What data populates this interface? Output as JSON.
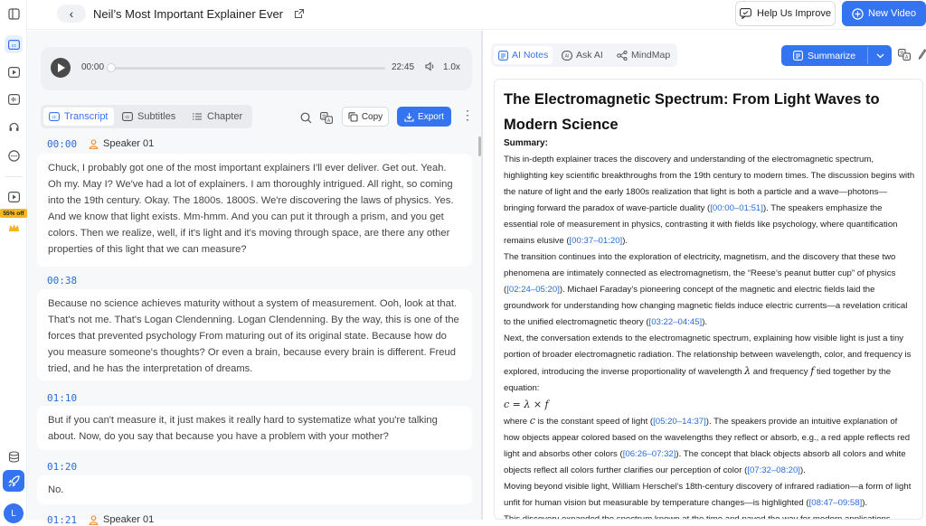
{
  "header": {
    "title": "Neil’s Most Important Explainer Ever",
    "help_label": "Help Us Improve",
    "new_video_label": "New Video"
  },
  "sidebar": {
    "badge": "55% off",
    "avatar_letter": "L"
  },
  "player": {
    "current_time": "00:00",
    "duration": "22:45",
    "speed": "1.0x",
    "progress": 0
  },
  "left_tabs": [
    "Transcript",
    "Subtitles",
    "Chapter"
  ],
  "toolbar": {
    "copy_label": "Copy",
    "export_label": "Export"
  },
  "segments": [
    {
      "time": "00:00",
      "speaker": "Speaker 01",
      "text": "Chuck, I probably got one of the most important explainers I'll ever deliver. Get out. Yeah. Oh my. May I? We've had a lot of explainers. I am thoroughly intrigued. All right, so coming into the 19th century. Okay. The 1800s. 1800S. We're discovering the laws of physics. Yes. And we know that light exists. Mm-hmm. And you can put it through a prism, and you get colors. Then we realize, well, if it's light and it's moving through space, are there any other properties of this light that we can measure?"
    },
    {
      "time": "00:38",
      "speaker": "",
      "text": "Because no science achieves maturity without a system of measurement. Ooh, look at that. That's not me. That's Logan Clendenning. Logan Clendenning. By the way, this is one of the forces that prevented psychology From maturing out of its original state. Because how do you measure someone's thoughts? Or even a brain, because every brain is different. Freud tried, and he has the interpretation of dreams."
    },
    {
      "time": "01:10",
      "speaker": "",
      "text": "But if you can't measure it, it just makes it really hard to systematize what you're talking about. Now, do you say that because you have a problem with your mother?"
    },
    {
      "time": "01:20",
      "speaker": "",
      "text": "No."
    },
    {
      "time": "01:21",
      "speaker": "Speaker 01",
      "text": ""
    }
  ],
  "right_tabs": [
    "AI Notes",
    "Ask AI",
    "MindMap"
  ],
  "summarize_label": "Summarize",
  "notes": {
    "title": "The Electromagnetic Spectrum: From Light Waves to Modern Science",
    "summary_label": "Summary:",
    "p1a": "This in-depth explainer traces the discovery and understanding of the electromagnetic spectrum, highlighting key scientific breakthroughs from the 19th century to modern times. The discussion begins with the nature of light and the early 1800s realization that light is both a particle and a wave—photons—bringing forward the paradox of wave-particle duality (",
    "ts1": "[00:00–01:51]",
    "p1b": "). The speakers emphasize the essential role of measurement in physics, contrasting it with fields like psychology, where quantification remains elusive (",
    "ts2": "[00:37–01:20]",
    "p1c": ").",
    "p2a": "The transition continues into the exploration of electricity, magnetism, and the discovery that these two phenomena are intimately connected as electromagnetism, the “Reese’s peanut butter cup” of physics (",
    "ts3": "[02:24–05:20]",
    "p2b": "). Michael Faraday’s pioneering concept of the magnetic and electric fields laid the groundwork for understanding how changing magnetic fields induce electric currents—a revelation critical to the unified electromagnetic theory (",
    "ts4": "[03:22–04:45]",
    "p2c": ").",
    "p3a": "Next, the conversation extends to the electromagnetic spectrum, explaining how visible light is just a tiny portion of broader electromagnetic radiation. The relationship between wavelength, color, and frequency is explored, introducing the inverse proportionality of wavelength ",
    "sym_lambda": "λ",
    "p3b": " and frequency ",
    "sym_f": "f",
    "p3c": " tied together by the equation:",
    "equation": "c = λ × f",
    "p4a": "where ",
    "sym_c": "c",
    "p4b": " is the constant speed of light (",
    "ts5": "[05:20–14:37]",
    "p4c": "). The speakers provide an intuitive explanation of how objects appear colored based on the wavelengths they reflect or absorb, e.g., a red apple reflects red light and absorbs other colors (",
    "ts6": "[06:26–07:32]",
    "p4d": "). The concept that black objects absorb all colors and white objects reflect all colors further clarifies our perception of color (",
    "ts7": "[07:32–08:20]",
    "p4e": ").",
    "p5a": "Moving beyond visible light, William Herschel’s 18th-century discovery of infrared radiation—a form of light unfit for human vision but measurable by temperature changes—is highlighted (",
    "ts8": "[08:47–09:58]",
    "p5b": ").",
    "p6": "This discovery expanded the spectrum known at the time and paved the way for modern applications."
  }
}
